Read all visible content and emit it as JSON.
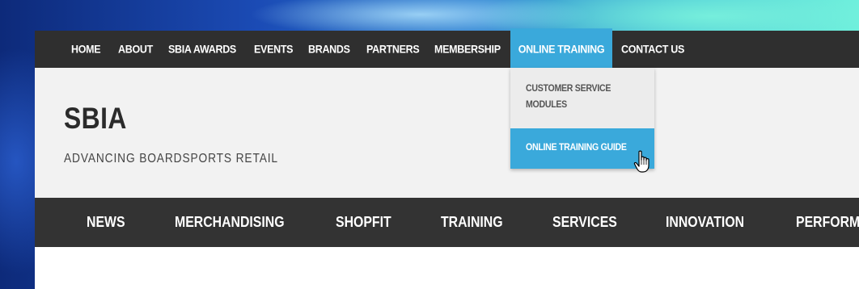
{
  "top_nav": {
    "items": [
      "HOME",
      "ABOUT",
      "SBIA AWARDS",
      "EVENTS",
      "BRANDS",
      "PARTNERS",
      "MEMBERSHIP",
      "ONLINE TRAINING",
      "CONTACT US"
    ],
    "active_item": "ONLINE TRAINING"
  },
  "header": {
    "logo": "SBIA",
    "tagline": "ADVANCING BOARDSPORTS RETAIL"
  },
  "dropdown": {
    "items": [
      "CUSTOMER SERVICE MODULES",
      "ONLINE TRAINING GUIDE"
    ],
    "item_0_line1": "CUSTOMER SERVICE",
    "item_0_line2": "MODULES",
    "highlighted_item": "ONLINE TRAINING GUIDE"
  },
  "category_nav": {
    "items": [
      "NEWS",
      "MERCHANDISING",
      "SHOPFIT",
      "TRAINING",
      "SERVICES",
      "INNOVATION",
      "PERFORMA"
    ]
  },
  "colors": {
    "nav_bg": "#2f2f2f",
    "accent": "#3aa9db",
    "header_bg": "#f2f2f2",
    "category_bg": "#333333"
  },
  "icons": {
    "cursor": "hand-pointer-icon"
  }
}
